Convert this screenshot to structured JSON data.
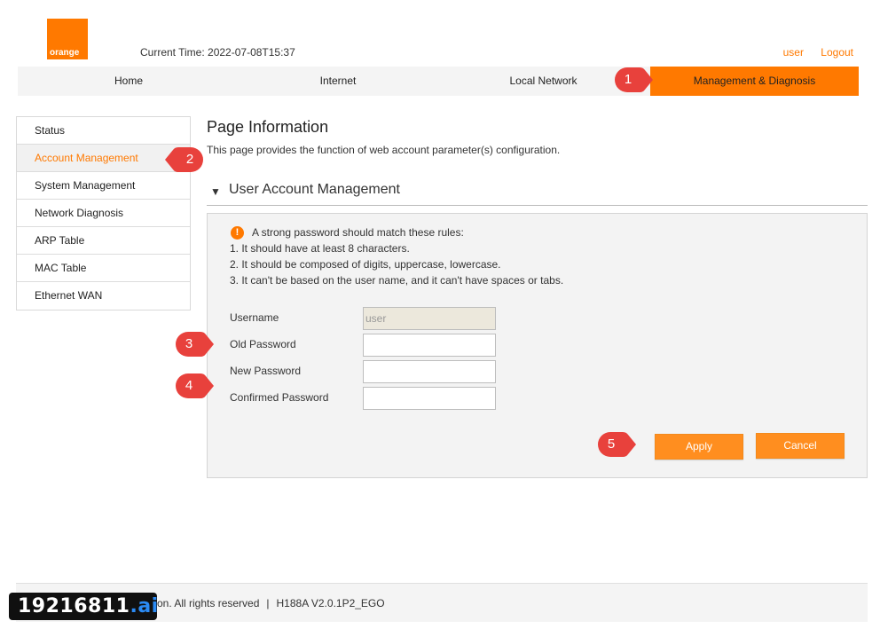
{
  "header": {
    "logo_text": "orange",
    "current_time_label": "Current Time:",
    "current_time_value": "2022-07-08T15:37",
    "user_link": "user",
    "logout_link": "Logout"
  },
  "nav": {
    "tabs": [
      {
        "label": "Home"
      },
      {
        "label": "Internet"
      },
      {
        "label": "Local Network"
      },
      {
        "label": "Management & Diagnosis"
      }
    ]
  },
  "sidebar": {
    "items": [
      {
        "label": "Status"
      },
      {
        "label": "Account Management"
      },
      {
        "label": "System Management"
      },
      {
        "label": "Network Diagnosis"
      },
      {
        "label": "ARP Table"
      },
      {
        "label": "MAC Table"
      },
      {
        "label": "Ethernet WAN"
      }
    ]
  },
  "main": {
    "page_title": "Page Information",
    "page_description": "This page provides the function of web account parameter(s) configuration.",
    "section_title": "User Account Management",
    "rules": {
      "intro": "A strong password should match these rules:",
      "lines": [
        "1. It should have at least 8 characters.",
        "2. It should be composed of digits, uppercase, lowercase.",
        "3. It can't be based on the user name, and it can't have spaces or tabs."
      ]
    },
    "form": {
      "username_label": "Username",
      "username_value": "user",
      "old_password_label": "Old Password",
      "old_password_value": "",
      "new_password_label": "New Password",
      "new_password_value": "",
      "confirm_password_label": "Confirmed Password",
      "confirm_password_value": ""
    },
    "buttons": {
      "apply": "Apply",
      "cancel": "Cancel"
    }
  },
  "footer": {
    "copyright_fragment": "on. All rights reserved",
    "separator": "|",
    "firmware": "H188A V2.0.1P2_EGO"
  },
  "watermark": {
    "main": "19216811",
    "suffix": ".ai"
  },
  "callouts": [
    "1",
    "2",
    "3",
    "4",
    "5"
  ],
  "colors": {
    "accent": "#ff7900",
    "callout": "#e8413c",
    "button": "#ff8e1f"
  },
  "icons": {
    "info": "info-icon",
    "collapse": "triangle-down-icon"
  }
}
